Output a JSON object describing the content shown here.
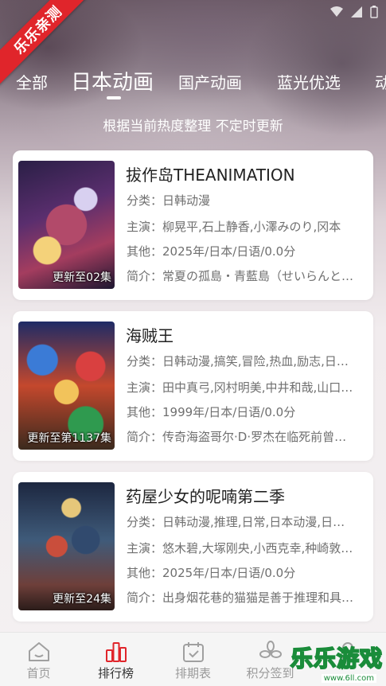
{
  "badge": {
    "text": "乐乐亲测"
  },
  "tabs": [
    {
      "label": "全部",
      "active": false
    },
    {
      "label": "日本动画",
      "active": true
    },
    {
      "label": "国产动画",
      "active": false
    },
    {
      "label": "蓝光优选",
      "active": false
    },
    {
      "label": "动",
      "active": false
    }
  ],
  "subtitle": "根据当前热度整理 不定时更新",
  "items": [
    {
      "title": "拔作岛THEANIMATION",
      "category": "分类：日韩动漫",
      "cast": "主演：柳晃平,石上静香,小澤みのり,冈本",
      "other": "其他：2025年/日本/日语/0.0分",
      "summary": "简介：常夏の孤島・青藍島（せいらんと…",
      "episode": "更新至02集"
    },
    {
      "title": "海贼王",
      "category": "分类：日韩动漫,搞笑,冒险,热血,励志,日…",
      "cast": "主演：田中真弓,冈村明美,中井和哉,山口…",
      "other": "其他：1999年/日本/日语/0.0分",
      "summary": "简介：传奇海盗哥尔·D·罗杰在临死前曾…",
      "episode": "更新至第1137集"
    },
    {
      "title": "药屋少女的呢喃第二季",
      "category": "分类：日韩动漫,推理,日常,日本动漫,日…",
      "cast": "主演：悠木碧,大塚刚央,小西克幸,种崎敦…",
      "other": "其他：2025年/日本/日语/0.0分",
      "summary": "简介：出身烟花巷的猫猫是善于推理和具…",
      "episode": "更新至24集"
    }
  ],
  "nav": [
    {
      "label": "首页",
      "icon": "home-icon",
      "active": false
    },
    {
      "label": "排行榜",
      "icon": "ranking-icon",
      "active": true
    },
    {
      "label": "排期表",
      "icon": "calendar-icon",
      "active": false
    },
    {
      "label": "积分签到",
      "icon": "flower-icon",
      "active": false
    },
    {
      "label": "",
      "icon": "user-icon",
      "active": false
    }
  ],
  "watermark": {
    "text": "乐乐游戏",
    "url": "www.6ll.com"
  },
  "colors": {
    "accent": "#e0252b",
    "text": "#222222",
    "muted": "#6f6f6f",
    "watermark": "#1a8c3a"
  }
}
